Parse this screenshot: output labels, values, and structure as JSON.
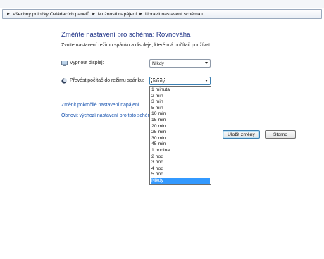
{
  "breadcrumb": {
    "items": [
      "Všechny položky Ovládacích panelů",
      "Možnosti napájení",
      "Upravit nastavení schématu"
    ]
  },
  "page": {
    "title": "Změňte nastavení pro schéma: Rovnováha",
    "subtitle": "Zvolte nastavení režimu spánku a displeje, které má počítač používat."
  },
  "settings": {
    "display_off": {
      "label": "Vypnout displej:",
      "value": "Nikdy",
      "icon": "monitor-icon"
    },
    "sleep": {
      "label": "Převést počítač do režimu spánku:",
      "value": "Nikdy",
      "icon": "moon-icon"
    }
  },
  "links": {
    "advanced": "Změnit pokročilé nastavení napájení",
    "restore": "Obnovit výchozí nastavení pro toto schém"
  },
  "buttons": {
    "save": "Uložit změny",
    "cancel": "Storno"
  },
  "dropdown": {
    "options": [
      "1 minuta",
      "2 min",
      "3 min",
      "5 min",
      "10 min",
      "15 min",
      "20 min",
      "25 min",
      "30 min",
      "45 min",
      "1 hodina",
      "2 hod",
      "3 hod",
      "4 hod",
      "5 hod",
      "Nikdy"
    ],
    "selected_index": 15,
    "selected_color": "#3399ff"
  },
  "colors": {
    "title": "#1e3287",
    "link": "#1a55b0",
    "accent": "#3c7fb1"
  }
}
